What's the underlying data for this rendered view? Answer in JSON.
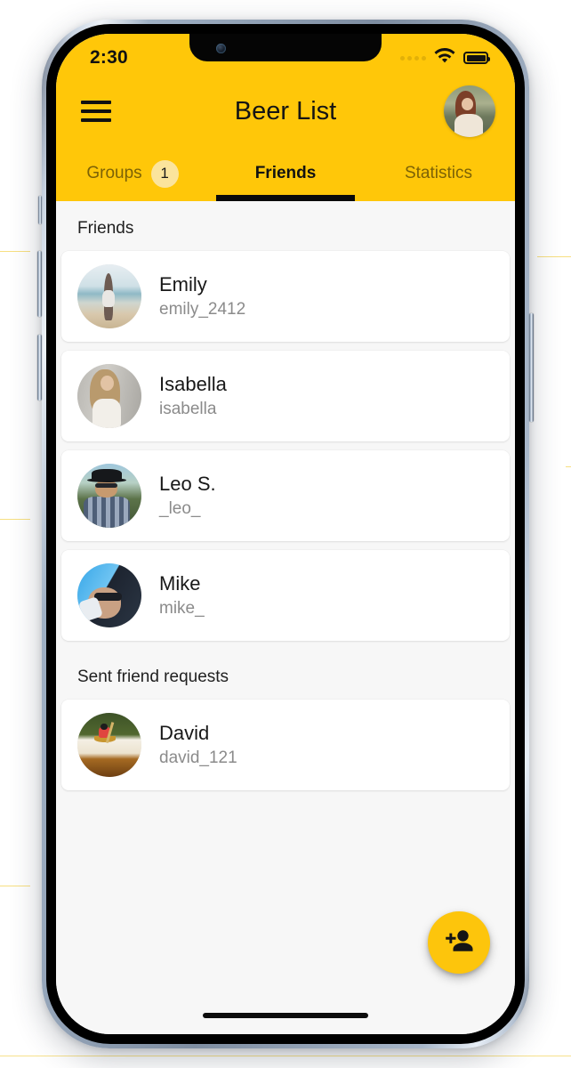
{
  "statusbar": {
    "time": "2:30",
    "signal_icon": "signal-dots-icon",
    "wifi_icon": "wifi-icon",
    "battery_icon": "battery-full-icon"
  },
  "appbar": {
    "menu_icon": "hamburger-menu-icon",
    "title": "Beer List",
    "avatar_icon": "profile-avatar"
  },
  "tabs": [
    {
      "label": "Groups",
      "badge": "1",
      "active": false
    },
    {
      "label": "Friends",
      "badge": "",
      "active": true
    },
    {
      "label": "Statistics",
      "badge": "",
      "active": false
    }
  ],
  "sections": [
    {
      "header": "Friends",
      "items": [
        {
          "name": "Emily",
          "username": "emily_2412"
        },
        {
          "name": "Isabella",
          "username": "isabella"
        },
        {
          "name": "Leo S.",
          "username": "_leo_"
        },
        {
          "name": "Mike",
          "username": "mike_"
        }
      ]
    },
    {
      "header": "Sent friend requests",
      "items": [
        {
          "name": "David",
          "username": "david_121"
        }
      ]
    }
  ],
  "fab": {
    "icon": "person-add-icon",
    "label": "Add friend"
  },
  "colors": {
    "brand_yellow": "#FFC709",
    "fab_yellow": "#FDC50C",
    "badge_yellow": "#FBE49C",
    "surface": "#F7F7F7",
    "card": "#FFFFFF",
    "text_primary": "#181818",
    "text_secondary": "#8B8B8B",
    "tab_inactive": "#7C6206"
  }
}
